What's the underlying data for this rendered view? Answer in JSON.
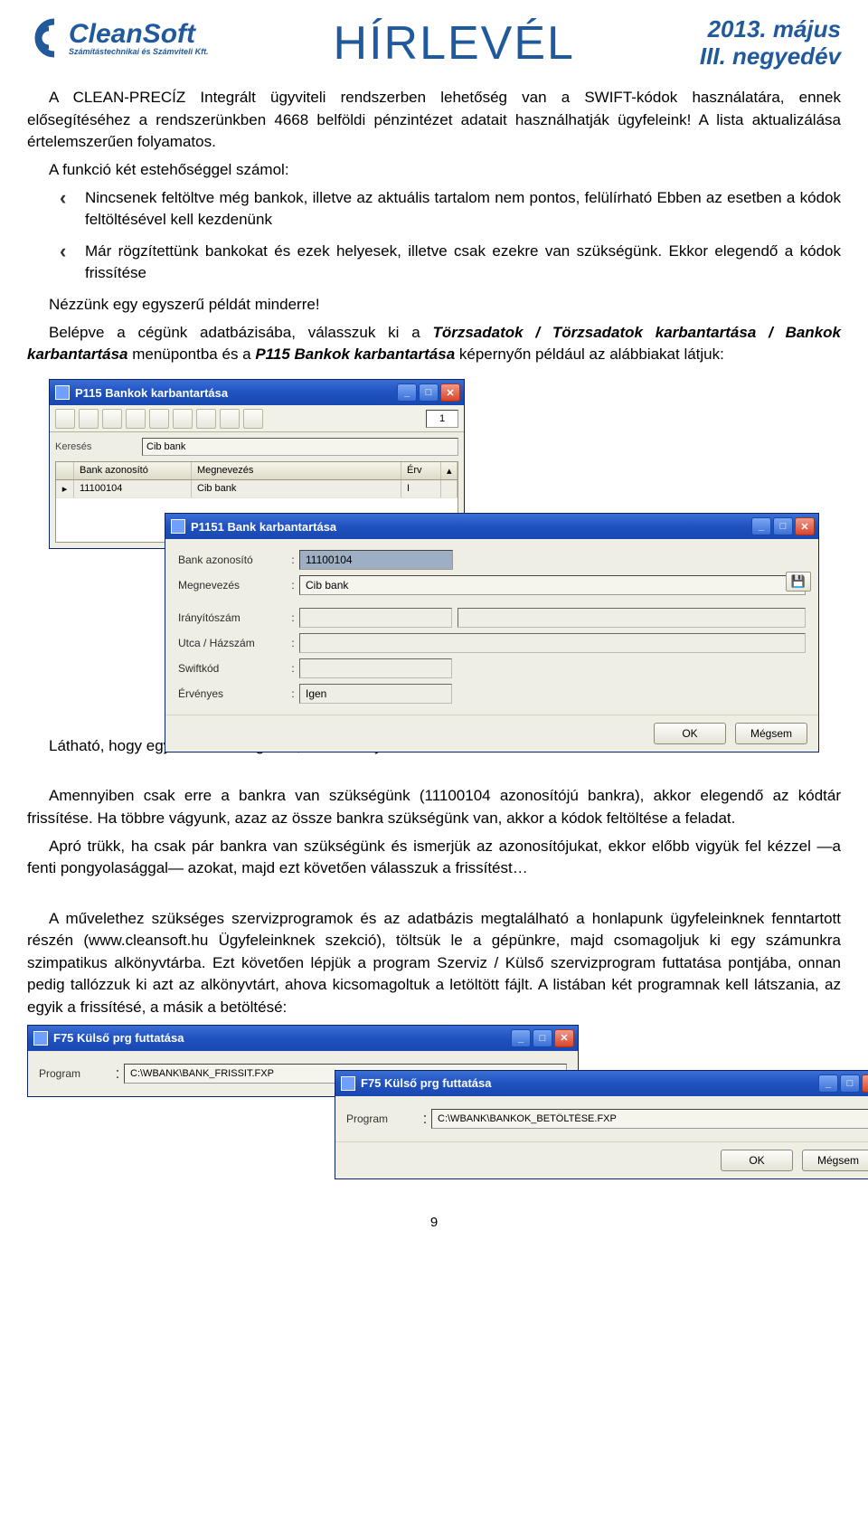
{
  "header": {
    "logo_text": "CleanSoft",
    "logo_sub": "Számítástechnikai és Számviteli Kft.",
    "title": "HÍRLEVÉL",
    "date_line1": "2013. május",
    "date_line2": "III. negyedév"
  },
  "para1": "A CLEAN-PRECÍZ Integrált ügyviteli rendszerben lehetőség van a SWIFT-kódok használatára, ennek elősegítéséhez a rendszerünkben 4668 belföldi pénzintézet adatait használhatják ügyfeleink! A lista aktualizálása értelemszerűen folyamatos.",
  "para2": "A funkció két estehőséggel számol:",
  "bullets": [
    "Nincsenek feltöltve még bankok, illetve az aktuális tartalom nem pontos, felülírható Ebben az esetben a kódok feltöltésével kell kezdenünk",
    "Már rögzítettünk bankokat és ezek helyesek, illetve csak ezekre van szükségünk. Ekkor elegendő a kódok frissítése"
  ],
  "para3a": "Nézzünk egy egyszerű példát minderre!",
  "para3b_pre": "Belépve a cégünk adatbázisába, válasszuk ki a ",
  "para3b_ital": "Törzsadatok / Törzsadatok karbantartása / Bankok karbantartása",
  "para3b_mid": " menüpontba és a ",
  "para3b_ital2": "P115 Bankok karbantartása",
  "para3b_post": " képernyőn például az alábbiakat látjuk:",
  "win1": {
    "title": "P115 Bankok karbantartása",
    "page": "1",
    "search_label": "Keresés",
    "search_value": "Cib bank",
    "cols": {
      "id": "Bank azonosító",
      "name": "Megnevezés",
      "erv": "Érv"
    },
    "row": {
      "id": "11100104",
      "name": "Cib bank",
      "erv": "I"
    }
  },
  "win2": {
    "title": "P1151 Bank karbantartása",
    "fields": {
      "bank_id_label": "Bank azonosító",
      "bank_id_value": "11100104",
      "name_label": "Megnevezés",
      "name_value": "Cib bank",
      "irsz_label": "Irányítószám",
      "irsz_value": "",
      "utca_label": "Utca / Házszám",
      "utca_value": "",
      "swift_label": "Swiftkód",
      "swift_value": "",
      "erv_label": "Érvényes",
      "erv_value": "Igen"
    },
    "ok": "OK",
    "cancel": "Mégsem"
  },
  "para4": "Látható, hogy egy bank van rögzítve, az is a helyes adatok nélkül!",
  "para5": "Amennyiben csak erre a bankra van szükségünk (11100104 azonosítójú bankra), akkor elegendő az kódtár frissítése. Ha többre vágyunk, azaz az össze bankra szükségünk van, akkor a kódok feltöltése a feladat.",
  "para6": "Apró trükk, ha csak pár bankra van szükségünk és ismerjük az azonosítójukat, ekkor előbb vigyük fel kézzel —a fenti pongyolasággal— azokat, majd ezt követően válasszuk a frissítést…",
  "para7": "A művelethez szükséges szervizprogramok és az adatbázis megtalálható a honlapunk ügyfeleinknek fenntartott részén (www.cleansoft.hu Ügyfeleinknek szekció), töltsük le a gépünkre, majd csomagoljuk ki egy számunkra szimpatikus alkönyvtárba. Ezt követően lépjük a program Szerviz / Külső szervizprogram futtatása pontjába, onnan pedig tallózzuk ki azt az alkönyvtárt, ahova kicsomagoltuk a letöltött fájlt. A listában két programnak kell látszania, az egyik a frissítésé, a másik a betöltésé:",
  "win3": {
    "title": "F75 Külső prg futtatása",
    "label": "Program",
    "value": "C:\\WBANK\\BANK_FRISSIT.FXP"
  },
  "win4": {
    "title": "F75 Külső prg futtatása",
    "label": "Program",
    "value": "C:\\WBANK\\BANKOK_BETÖLTÉSE.FXP",
    "ok": "OK",
    "cancel": "Mégsem"
  },
  "page_number": "9"
}
